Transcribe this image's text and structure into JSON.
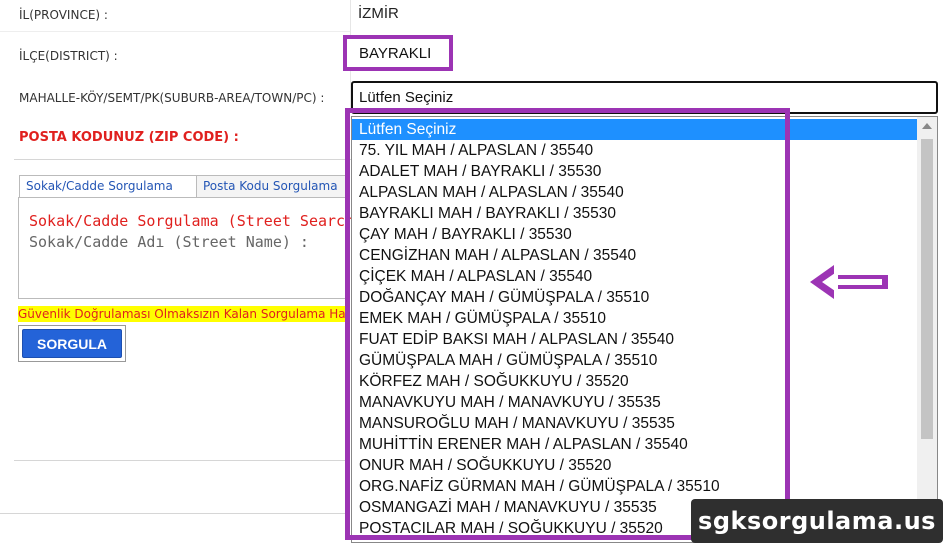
{
  "form": {
    "province_label": "İL(PROVINCE) :",
    "province_value": "İZMİR",
    "district_label": "İLÇE(DISTRICT) :",
    "district_value": "BAYRAKLI",
    "neighborhood_label": "MAHALLE-KÖY/SEMT/PK(SUBURB-AREA/TOWN/PC) :",
    "neighborhood_selected": "Lütfen Seçiniz",
    "zip_label": "POSTA KODUNUZ (ZIP CODE) :"
  },
  "tabs": [
    {
      "label": "Sokak/Cadde Sorgulama"
    },
    {
      "label": "Posta Kodu Sorgulama"
    }
  ],
  "panel": {
    "title": "Sokak/Cadde Sorgulama (Street Search)",
    "street_label": "Sokak/Cadde Adı (Street Name) :"
  },
  "warning_text": "Güvenlik Doğrulaması Olmaksızın Kalan Sorgulama Hakkınız",
  "query_button": "SORGULA",
  "dropdown_options": [
    "Lütfen Seçiniz",
    "75. YIL MAH / ALPASLAN / 35540",
    "ADALET MAH / BAYRAKLI / 35530",
    "ALPASLAN MAH / ALPASLAN / 35540",
    "BAYRAKLI MAH / BAYRAKLI / 35530",
    "ÇAY MAH / BAYRAKLI / 35530",
    "CENGİZHAN MAH / ALPASLAN / 35540",
    "ÇİÇEK MAH / ALPASLAN / 35540",
    "DOĞANÇAY MAH / GÜMÜŞPALA / 35510",
    "EMEK MAH / GÜMÜŞPALA / 35510",
    "FUAT EDİP BAKSI MAH / ALPASLAN / 35540",
    "GÜMÜŞPALA MAH / GÜMÜŞPALA / 35510",
    "KÖRFEZ MAH / SOĞUKKUYU / 35520",
    "MANAVKUYU MAH / MANAVKUYU / 35535",
    "MANSUROĞLU MAH / MANAVKUYU / 35535",
    "MUHİTTİN ERENER MAH / ALPASLAN / 35540",
    "ONUR MAH / SOĞUKKUYU / 35520",
    "ORG.NAFİZ GÜRMAN MAH / GÜMÜŞPALA / 35510",
    "OSMANGAZİ MAH / MANAVKUYU / 35535",
    "POSTACILAR MAH / SOĞUKKUYU / 35520"
  ],
  "watermark": "sgksorgulama.us",
  "colors": {
    "highlight": "#9c34b4",
    "selected_option": "#1e90ff",
    "button": "#2463d8",
    "error_red": "#e0201e",
    "warning_bg": "#ffff00"
  },
  "icons": {
    "annotation": "left-arrow-icon"
  }
}
